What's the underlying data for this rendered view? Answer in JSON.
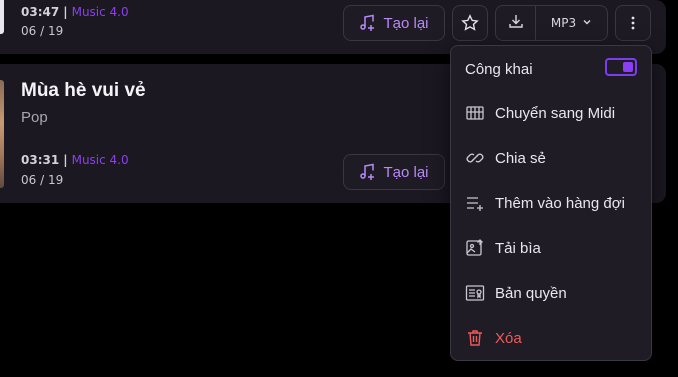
{
  "tracks": [
    {
      "duration": "03:47",
      "separator": "|",
      "model": "Music 4.0",
      "counter": "06 / 19",
      "retry_label": "Tạo lại",
      "format": "MP3"
    },
    {
      "title": "Mùa hè vui vẻ",
      "genre": "Pop",
      "duration": "03:31",
      "separator": "|",
      "model": "Music 4.0",
      "counter": "06 / 19",
      "retry_label": "Tạo lại"
    }
  ],
  "menu": {
    "public_label": "Công khai",
    "public_enabled": true,
    "items": [
      {
        "label": "Chuyển sang Midi",
        "icon": "piano-icon"
      },
      {
        "label": "Chia sẻ",
        "icon": "link-icon"
      },
      {
        "label": "Thêm vào hàng đợi",
        "icon": "queue-add-icon"
      },
      {
        "label": "Tải bìa",
        "icon": "image-upload-icon"
      },
      {
        "label": "Bản quyền",
        "icon": "license-icon"
      },
      {
        "label": "Xóa",
        "icon": "trash-icon"
      }
    ]
  },
  "colors": {
    "accent": "#8b3ff0",
    "card_bg": "#1b1822",
    "danger": "#ef5a5a"
  }
}
